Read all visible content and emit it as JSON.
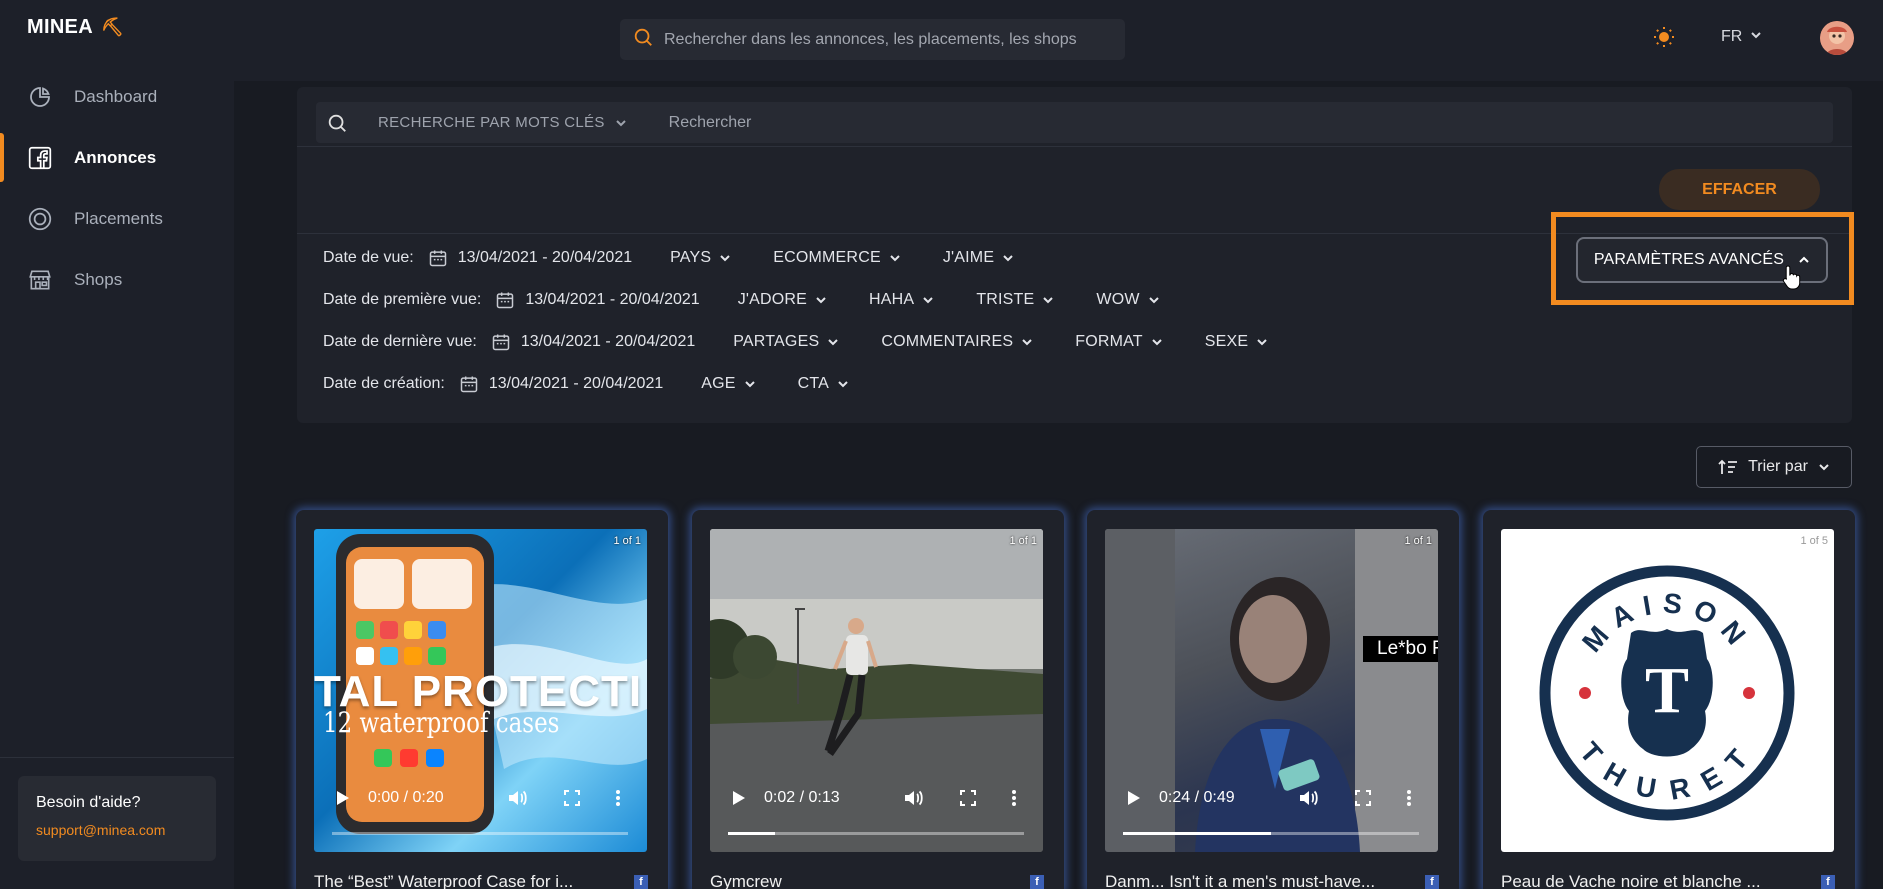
{
  "app": {
    "logo": "MINEA"
  },
  "sidebar": {
    "items": [
      {
        "label": "Dashboard",
        "icon": "pie-chart-icon",
        "active": false
      },
      {
        "label": "Annonces",
        "icon": "facebook-icon",
        "active": true
      },
      {
        "label": "Placements",
        "icon": "instagram-icon",
        "active": false
      },
      {
        "label": "Shops",
        "icon": "store-icon",
        "active": false
      }
    ],
    "help": {
      "title": "Besoin d'aide?",
      "email": "support@minea.com"
    }
  },
  "topbar": {
    "search_placeholder": "Rechercher dans les annonces, les placements, les shops",
    "language": "FR"
  },
  "filters": {
    "keyword_mode": "RECHERCHE PAR MOTS CLÉS",
    "keyword_placeholder": "Rechercher",
    "clear_label": "EFFACER",
    "advanced_label": "PARAMÈTRES AVANCÉS",
    "rows": [
      {
        "label": "Date de vue:",
        "date": "13/04/2021 - 20/04/2021",
        "dropdowns": [
          "PAYS",
          "ECOMMERCE",
          "J'AIME"
        ]
      },
      {
        "label": "Date de première vue:",
        "date": "13/04/2021 - 20/04/2021",
        "dropdowns": [
          "J'ADORE",
          "HAHA",
          "TRISTE",
          "WOW"
        ]
      },
      {
        "label": "Date de dernière vue:",
        "date": "13/04/2021 - 20/04/2021",
        "dropdowns": [
          "PARTAGES",
          "COMMENTAIRES",
          "FORMAT",
          "SEXE"
        ]
      },
      {
        "label": "Date de création:",
        "date": "13/04/2021 - 20/04/2021",
        "dropdowns": [
          "AGE",
          "CTA"
        ]
      }
    ]
  },
  "sort": {
    "label": "Trier par"
  },
  "cards": [
    {
      "title": "The “Best” Waterproof Case for i...",
      "counter": "1 of 1",
      "time": "0:00 / 0:20",
      "progress": 0.0,
      "overlay_big": "TAL PROTECTI",
      "overlay_small": "12 waterproof cases"
    },
    {
      "title": "Gymcrew",
      "counter": "1 of 1",
      "time": "0:02 / 0:13",
      "progress": 0.16
    },
    {
      "title": "Danm... Isn't it a men's must-have...",
      "counter": "1 of 1",
      "time": "0:24 / 0:49",
      "progress": 0.5,
      "overlay_caption": "Le*bo F"
    },
    {
      "title": "Peau de Vache noire et blanche ...",
      "counter": "1 of 5",
      "logo_top": "MAISON",
      "logo_bottom": "THURET",
      "logo_letter": "T"
    }
  ],
  "colors": {
    "accent": "#f28b20",
    "bg": "#181b22",
    "panel": "#1f222a",
    "card_glow": "#466ec8"
  }
}
